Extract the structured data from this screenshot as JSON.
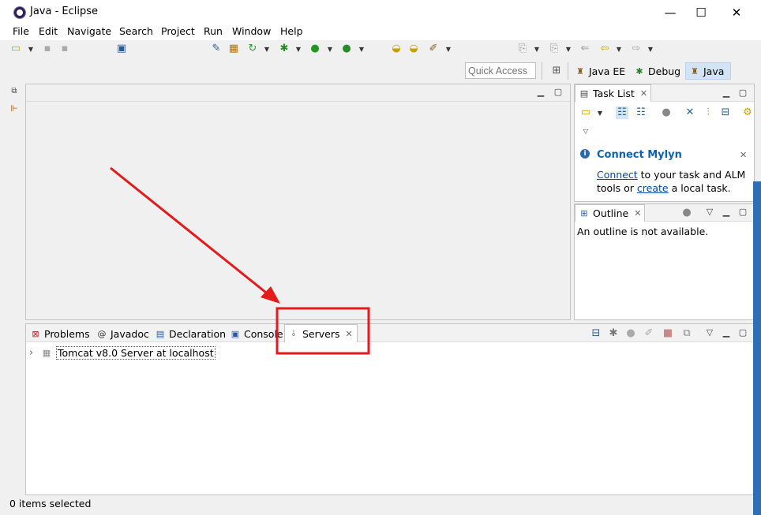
{
  "window": {
    "title": "Java - Eclipse"
  },
  "window_controls": {
    "minimize": "—",
    "maximize": "☐",
    "close": "✕"
  },
  "menu": [
    "File",
    "Edit",
    "Navigate",
    "Search",
    "Project",
    "Run",
    "Window",
    "Help"
  ],
  "quick_access": {
    "placeholder": "Quick Access"
  },
  "perspectives": [
    {
      "label": "Java EE",
      "icon": "java-ee-perspective-icon"
    },
    {
      "label": "Debug",
      "icon": "bug-icon"
    },
    {
      "label": "Java",
      "icon": "java-perspective-icon",
      "active": true
    }
  ],
  "task_list": {
    "title": "Task List"
  },
  "mylyn": {
    "title": "Connect Mylyn",
    "connect_link": "Connect",
    "text_1": " to your task and ALM",
    "text_2": "tools or ",
    "create_link": "create",
    "text_3": " a local task."
  },
  "outline": {
    "title": "Outline",
    "message": "An outline is not available."
  },
  "bottom_tabs": [
    {
      "label": "Problems",
      "icon": "problems-icon"
    },
    {
      "label": "Javadoc",
      "icon": "at-icon"
    },
    {
      "label": "Declaration",
      "icon": "declaration-icon"
    },
    {
      "label": "Console",
      "icon": "console-icon"
    },
    {
      "label": "Servers",
      "icon": "servers-icon",
      "active": true
    }
  ],
  "servers": [
    {
      "label": "Tomcat v8.0 Server at localhost",
      "expand": "›"
    }
  ],
  "status": {
    "text": "0 items selected"
  },
  "colors": {
    "accent_blue": "#0a64b4",
    "annotation_red": "#e51a1a",
    "active_tab_bg": "#ffffff",
    "perspective_active": "#d3e5f5"
  }
}
